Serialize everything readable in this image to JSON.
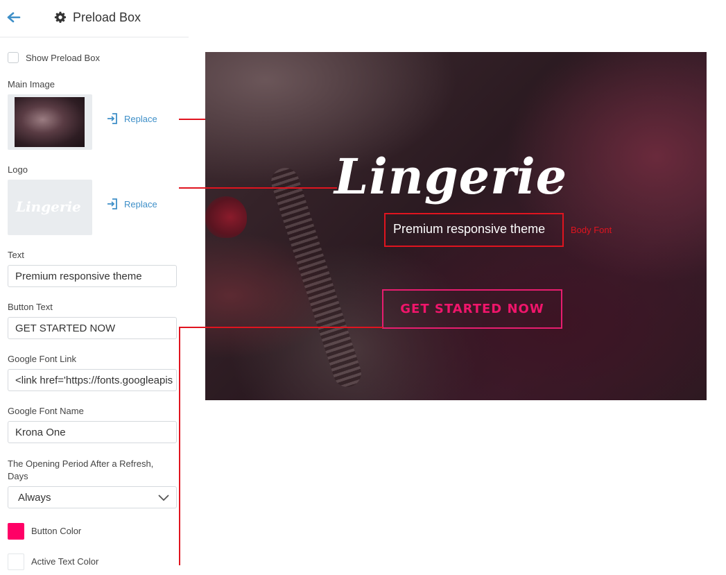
{
  "header": {
    "title": "Preload Box",
    "back_icon": "arrow-left-icon",
    "settings_icon": "gear-icon"
  },
  "sidebar": {
    "show_preload_box": {
      "label": "Show Preload Box",
      "checked": false
    },
    "main_image": {
      "label": "Main Image",
      "replace_label": "Replace"
    },
    "logo": {
      "label": "Logo",
      "replace_label": "Replace",
      "logo_text": "Lingerie"
    },
    "text_field": {
      "label": "Text",
      "value": "Premium responsive theme"
    },
    "button_text_field": {
      "label": "Button Text",
      "value": "GET STARTED NOW"
    },
    "google_font_link": {
      "label": "Google Font Link",
      "value": "<link href='https://fonts.googleapis"
    },
    "google_font_name": {
      "label": "Google Font Name",
      "value": "Krona One"
    },
    "opening_period": {
      "label": "The Opening Period After a Refresh, Days",
      "value": "Always"
    },
    "button_color": {
      "label": "Button Color",
      "color": "#ff0066"
    },
    "active_text_color": {
      "label": "Active Text Color",
      "color": "#ffffff"
    }
  },
  "preview": {
    "logo_text": "Lingerie",
    "tagline": "Premium responsive theme",
    "body_font_label": "Body Font",
    "cta_label": "GET STARTED NOW"
  },
  "colors": {
    "accent_blue": "#3e8fc8",
    "annotation_red": "#e0141f",
    "cta_pink": "#f0156b"
  }
}
